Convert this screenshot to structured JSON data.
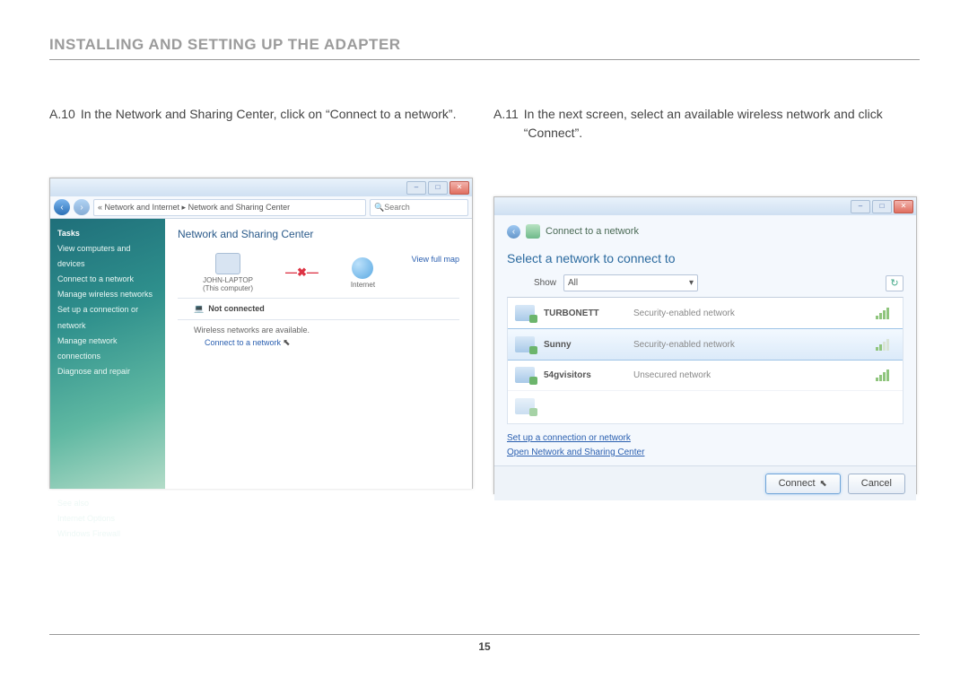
{
  "header": {
    "title": "INSTALLING AND SETTING UP THE ADAPTER"
  },
  "pageNumber": "15",
  "steps": {
    "a10": {
      "num": "A.10",
      "text": "In the Network and Sharing Center, click on “Connect to a network”."
    },
    "a11": {
      "num": "A.11",
      "text": "In the next screen, select an available wireless network and click “Connect”."
    }
  },
  "ssA": {
    "breadcrumb": "«  Network and Internet  ▸  Network and Sharing Center",
    "searchPlaceholder": "Search",
    "sidebar": {
      "heading": "Tasks",
      "items": [
        "View computers and devices",
        "Connect to a network",
        "Manage wireless networks",
        "Set up a connection or network",
        "Manage network connections",
        "Diagnose and repair"
      ],
      "seeAlso": [
        "See also",
        "Internet Options",
        "Windows Firewall"
      ]
    },
    "main": {
      "title": "Network and Sharing Center",
      "viewFullMap": "View full map",
      "node1": "JOHN-LAPTOP",
      "node1sub": "(This computer)",
      "node2": "Internet",
      "notConnected": "Not connected",
      "wirelessAvail": "Wireless networks are available.",
      "connectLink": "Connect to a network"
    },
    "win": {
      "min": "–",
      "max": "□",
      "close": "✕"
    }
  },
  "ssB": {
    "dlgTitle": "Connect to a network",
    "prompt": "Select a network to connect to",
    "showLabel": "Show",
    "showValue": "All",
    "networks": [
      {
        "name": "TURBONETT",
        "sec": "Security-enabled network",
        "sel": false,
        "weak": false
      },
      {
        "name": "Sunny",
        "sec": "Security-enabled network",
        "sel": true,
        "weak": true
      },
      {
        "name": "54gvisitors",
        "sec": "Unsecured network",
        "sel": false,
        "weak": false
      }
    ],
    "link1": "Set up a connection or network",
    "link2": "Open Network and Sharing Center",
    "connect": "Connect",
    "cancel": "Cancel",
    "win": {
      "min": "–",
      "max": "□",
      "close": "✕"
    }
  }
}
